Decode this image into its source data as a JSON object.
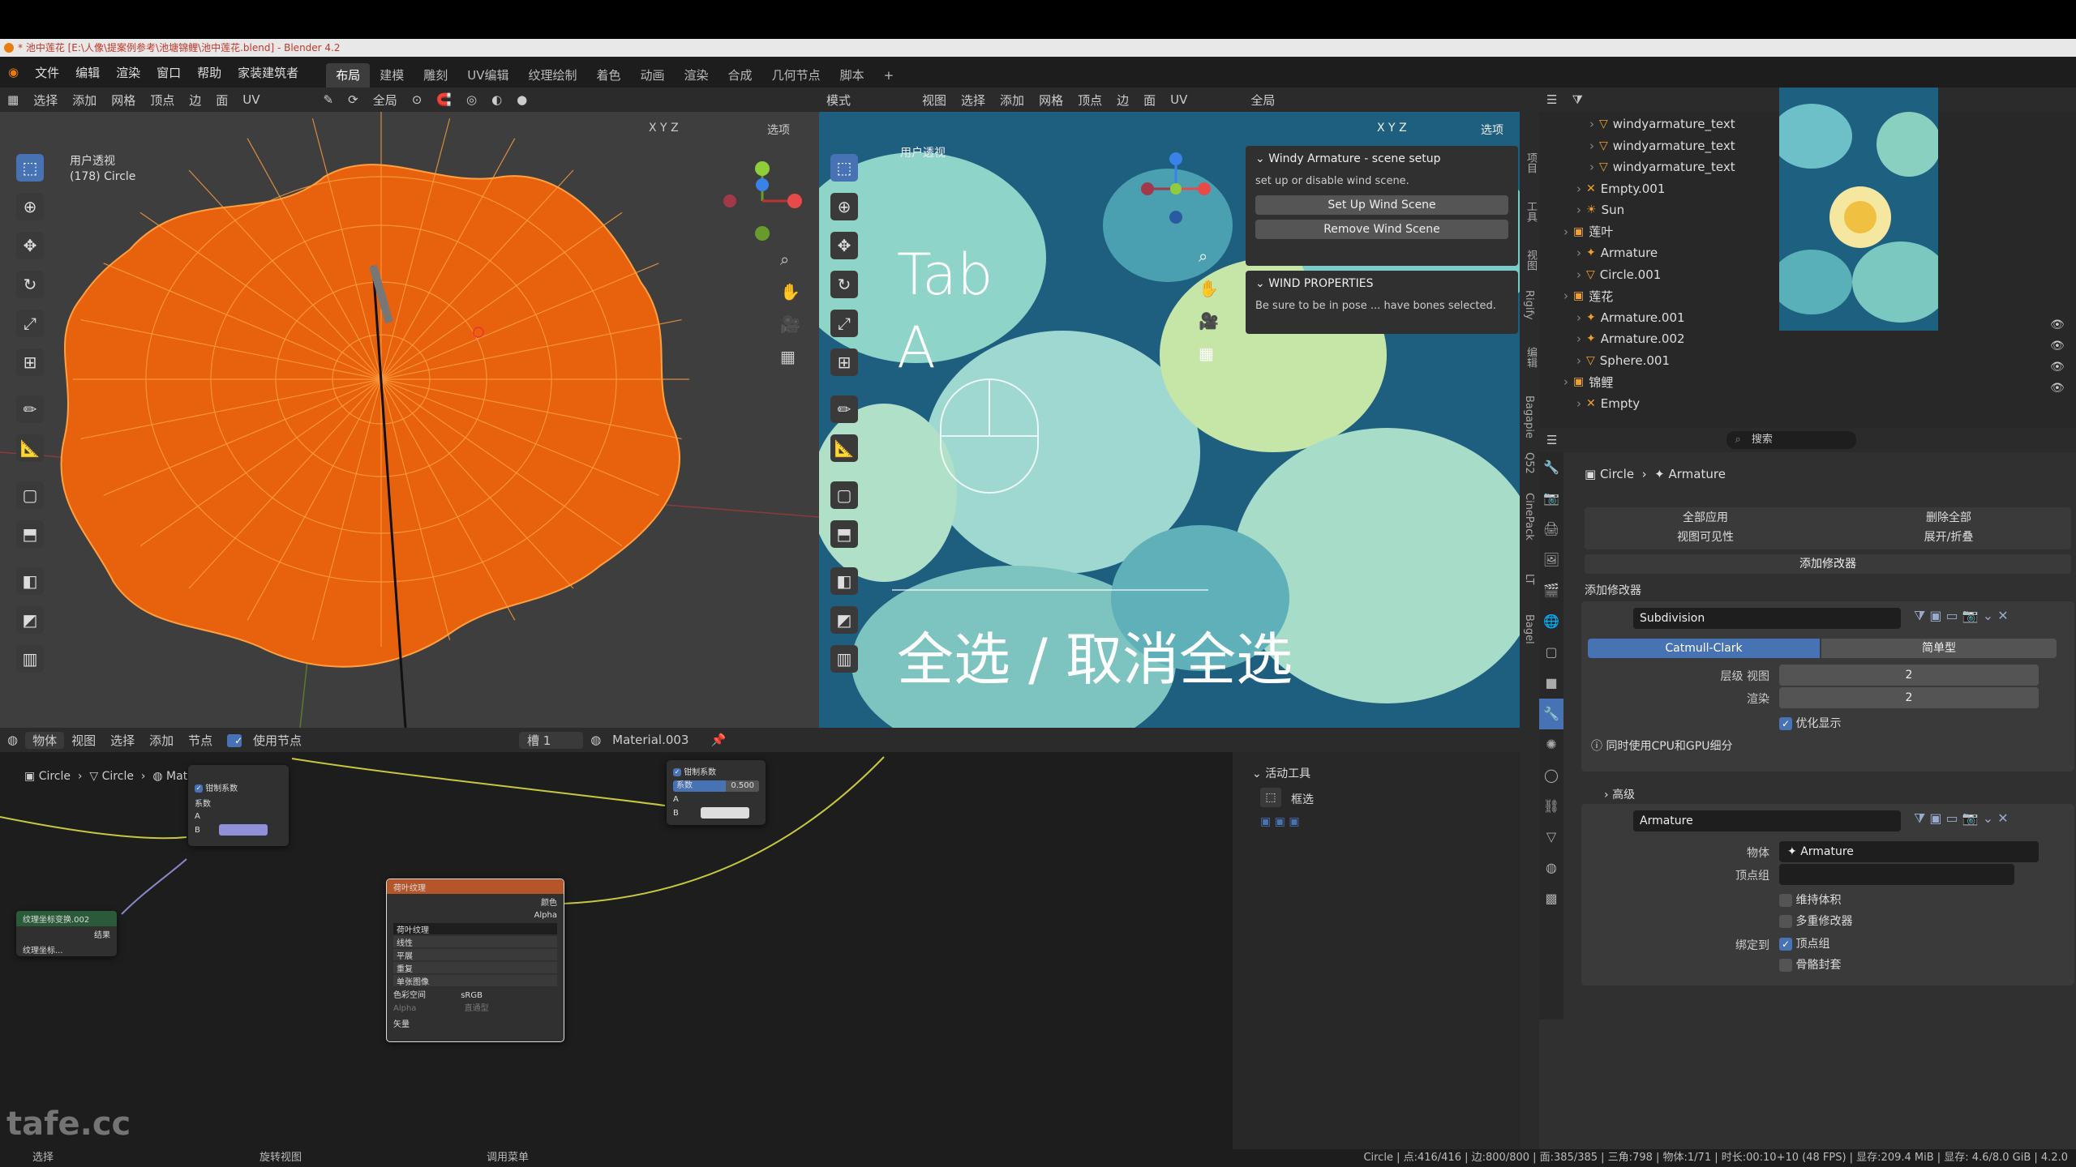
{
  "window": {
    "title": "* 池中莲花 [E:\\人像\\提案例参考\\池塘锦鲤\\池中莲花.blend] - Blender 4.2"
  },
  "menu": {
    "items": [
      "文件",
      "编辑",
      "渲染",
      "窗口",
      "帮助",
      "家装建筑者"
    ]
  },
  "workspaces": {
    "tabs": [
      "布局",
      "建模",
      "雕刻",
      "UV编辑",
      "纹理绘制",
      "着色",
      "动画",
      "渲染",
      "合成",
      "几何节点",
      "脚本"
    ],
    "active": "布局"
  },
  "left_viewport": {
    "header": [
      "选择",
      "添加",
      "网格",
      "顶点",
      "边",
      "面",
      "UV"
    ],
    "global_label": "全局",
    "options_label": "选项",
    "axes": [
      "X",
      "Y",
      "Z"
    ],
    "overlay_title": "用户透视",
    "overlay_object": "(178) Circle",
    "mesh_color": "#e8620e"
  },
  "right_viewport": {
    "mode_label": "模式",
    "header": [
      "视图",
      "选择",
      "添加",
      "网格",
      "顶点",
      "边",
      "面",
      "UV"
    ],
    "global_label": "全局",
    "options_label": "选项",
    "axes": [
      "X",
      "Y",
      "Z"
    ],
    "overlay_title": "用户透视",
    "big_tab": "Tab",
    "big_a": "A",
    "subtitle": "全选 / 取消全选",
    "wind_panel": {
      "title": "Windy Armature - scene setup",
      "desc": "set up or disable wind scene.",
      "setup_btn": "Set Up Wind Scene",
      "remove_btn": "Remove Wind Scene",
      "props_title": "WIND PROPERTIES",
      "props_desc": "Be sure to be in pose ... have bones selected."
    },
    "side_tabs": [
      "项目",
      "工具",
      "视图",
      "Rigify",
      "编辑",
      "Bagapie",
      "Q52",
      "CinePack",
      "LT",
      "Bagel"
    ]
  },
  "outliner": {
    "rows": [
      {
        "name": "windyarmature_text",
        "icon": "▽",
        "indent": 3
      },
      {
        "name": "windyarmature_text",
        "icon": "▽",
        "indent": 3
      },
      {
        "name": "windyarmature_text",
        "icon": "▽",
        "indent": 3
      },
      {
        "name": "Empty.001",
        "icon": "✕",
        "indent": 2
      },
      {
        "name": "Sun",
        "icon": "☀",
        "indent": 2
      },
      {
        "name": "莲叶",
        "icon": "▣",
        "indent": 1
      },
      {
        "name": "Armature",
        "icon": "✦",
        "indent": 2
      },
      {
        "name": "Circle.001",
        "icon": "▽",
        "indent": 2
      },
      {
        "name": "莲花",
        "icon": "▣",
        "indent": 1
      },
      {
        "name": "Armature.001",
        "icon": "✦",
        "indent": 2
      },
      {
        "name": "Armature.002",
        "icon": "✦",
        "indent": 2
      },
      {
        "name": "Sphere.001",
        "icon": "▽",
        "indent": 2
      },
      {
        "name": "锦鲤",
        "icon": "▣",
        "indent": 1
      },
      {
        "name": "Empty",
        "icon": "✕",
        "indent": 2
      }
    ]
  },
  "properties": {
    "search_placeholder": "搜索",
    "breadcrumb": [
      "Circle",
      "Armature"
    ],
    "apply_all": "全部应用",
    "delete_all": "删除全部",
    "viewport_vis": "视图可见性",
    "expand_collapse": "展开/折叠",
    "add_modifier_btn": "添加修改器",
    "add_modifier_header": "添加修改器",
    "subdivision": {
      "name": "Subdivision",
      "catmull": "Catmull-Clark",
      "simple": "简单型",
      "levels_label": "层级 视图",
      "levels": "2",
      "render_label": "渲染",
      "render": "2",
      "optimal": "优化显示",
      "gpu_label": "同时使用CPU和GPU细分",
      "advanced": "高级"
    },
    "armature": {
      "name": "Armature",
      "object_label": "物体",
      "object_value": "Armature",
      "vgroup_label": "顶点组",
      "preserve_volume": "维持体积",
      "multi_mod": "多重修改器",
      "bind_label": "绑定到",
      "bind_vgroups": "顶点组",
      "bind_envelopes": "骨骼封套"
    }
  },
  "node_editor": {
    "header": [
      "物体",
      "视图",
      "选择",
      "添加",
      "节点"
    ],
    "use_nodes": "使用节点",
    "slot": "槽 1",
    "material": "Material.003",
    "breadcrumb": [
      "Circle",
      "Circle",
      "Material.003"
    ],
    "active_tool_title": "活动工具",
    "active_tool_name": "框选",
    "node_mix_factor_label": "系数",
    "node_mix_factor_value": "0.500",
    "node_mix_clamp": "钳制系数",
    "node_tex_title": "荷叶纹理",
    "node_tex_color": "颜色",
    "node_tex_alpha": "Alpha",
    "node_tex_rows": [
      "线性",
      "平展",
      "重复",
      "单张图像"
    ],
    "node_tex_colorspace_label": "色彩空间",
    "node_tex_colorspace": "sRGB",
    "node_tex_alpha_label": "Alpha",
    "node_tex_alpha_mode": "直通型",
    "node_tex_vector": "矢量",
    "node_small_title": "纹理坐标变换.002",
    "node_small_out": "结果",
    "node_small_label": "纹理坐标..."
  },
  "statusbar": {
    "left1": "选择",
    "left2": "旋转视图",
    "left3": "调用菜单",
    "stats": "Circle | 点:416/416 | 边:800/800 | 面:385/385 | 三角:798 | 物体:1/71 | 时长:00:10+10 (48 FPS) | 显存:209.4 MiB | 显存: 4.6/8.0 GiB | 4.2.0"
  },
  "watermark": "tafe.cc",
  "colors": {
    "accent": "#4772b3",
    "orange": "#e8620e",
    "selected_row": "#334d80"
  }
}
